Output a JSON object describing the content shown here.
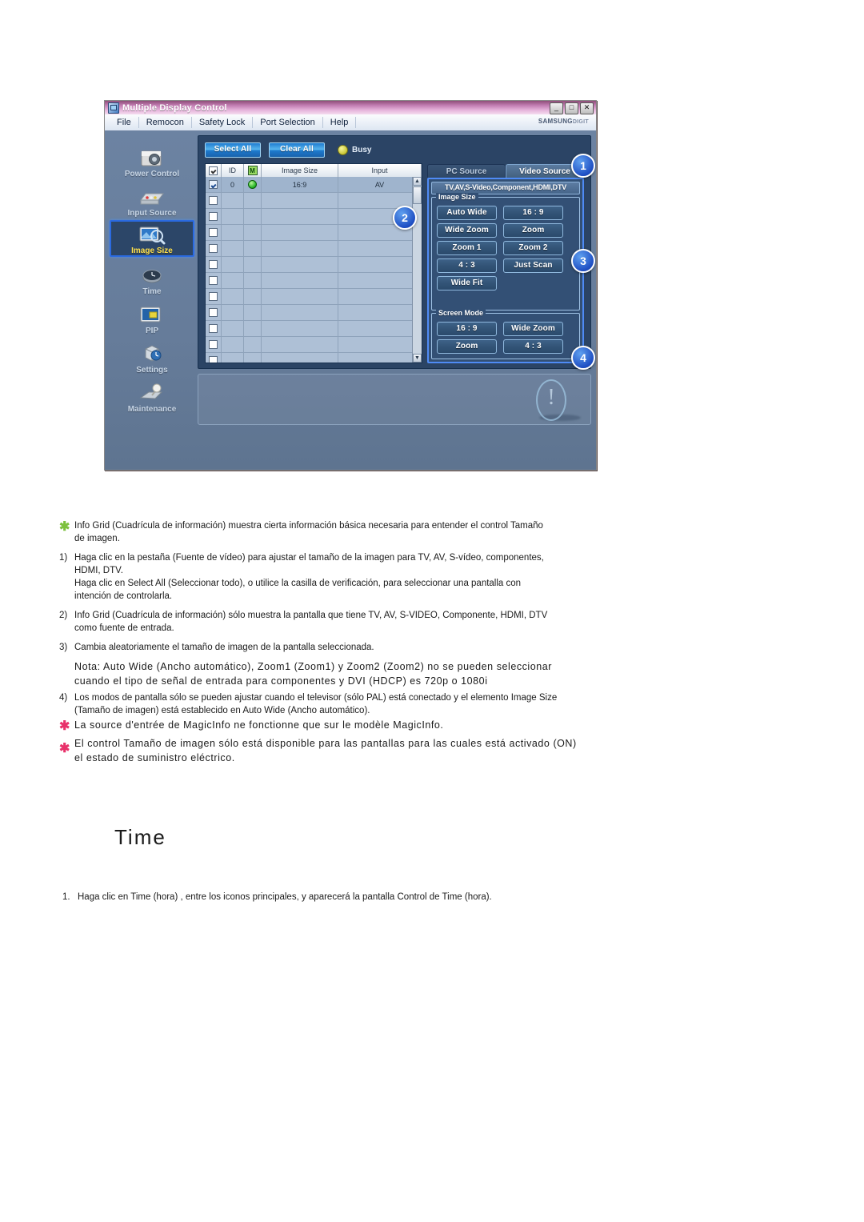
{
  "app": {
    "title": "Multiple Display Control",
    "window_buttons": [
      "_",
      "□",
      "✕"
    ],
    "brand": "SAMSUNG",
    "brand_sub": "DIGIT",
    "menu": [
      "File",
      "Remocon",
      "Safety Lock",
      "Port Selection",
      "Help"
    ],
    "sidebar": [
      {
        "label": "Power Control",
        "icon": "power-control-icon",
        "active": false
      },
      {
        "label": "Input Source",
        "icon": "input-source-icon",
        "active": false
      },
      {
        "label": "Image Size",
        "icon": "image-size-icon",
        "active": true
      },
      {
        "label": "Time",
        "icon": "time-icon",
        "active": false
      },
      {
        "label": "PIP",
        "icon": "pip-icon",
        "active": false
      },
      {
        "label": "Settings",
        "icon": "settings-icon",
        "active": false
      },
      {
        "label": "Maintenance",
        "icon": "maintenance-icon",
        "active": false
      }
    ],
    "toolbar": {
      "select_all": "Select All",
      "clear_all": "Clear All",
      "busy_label": "Busy",
      "busy_color": "#c9c634"
    },
    "grid": {
      "columns": [
        "",
        "ID",
        "",
        "Image Size",
        "Input"
      ],
      "header_check_icon": "checkbox-checked-icon",
      "header_power_icon": "power-column-icon",
      "rows": [
        {
          "checked": true,
          "id": "0",
          "led": "green",
          "image_size": "16:9",
          "input": "AV"
        },
        {
          "checked": false,
          "id": "",
          "led": "",
          "image_size": "",
          "input": ""
        },
        {
          "checked": false,
          "id": "",
          "led": "",
          "image_size": "",
          "input": ""
        },
        {
          "checked": false,
          "id": "",
          "led": "",
          "image_size": "",
          "input": ""
        },
        {
          "checked": false,
          "id": "",
          "led": "",
          "image_size": "",
          "input": ""
        },
        {
          "checked": false,
          "id": "",
          "led": "",
          "image_size": "",
          "input": ""
        },
        {
          "checked": false,
          "id": "",
          "led": "",
          "image_size": "",
          "input": ""
        },
        {
          "checked": false,
          "id": "",
          "led": "",
          "image_size": "",
          "input": ""
        },
        {
          "checked": false,
          "id": "",
          "led": "",
          "image_size": "",
          "input": ""
        },
        {
          "checked": false,
          "id": "",
          "led": "",
          "image_size": "",
          "input": ""
        },
        {
          "checked": false,
          "id": "",
          "led": "",
          "image_size": "",
          "input": ""
        },
        {
          "checked": false,
          "id": "",
          "led": "",
          "image_size": "",
          "input": ""
        }
      ],
      "scroll_up": "▲",
      "scroll_down": "▼"
    },
    "tabs": [
      {
        "label": "PC Source",
        "active": false
      },
      {
        "label": "Video Source",
        "active": true
      }
    ],
    "source_bar": "TV,AV,S-Video,Component,HDMI,DTV",
    "image_size_group": {
      "legend": "Image Size",
      "buttons": [
        "Auto Wide",
        "16 : 9",
        "Wide Zoom",
        "Zoom",
        "Zoom 1",
        "Zoom 2",
        "4 : 3",
        "Just Scan",
        "Wide Fit"
      ]
    },
    "screen_mode_group": {
      "legend": "Screen Mode",
      "buttons": [
        "16 : 9",
        "Wide Zoom",
        "Zoom",
        "4 : 3"
      ]
    },
    "callouts": [
      "1",
      "2",
      "3",
      "4"
    ],
    "accent_color": "#1f4fc4"
  },
  "doc": {
    "bullet1": {
      "marker": "✱",
      "line1": "Info Grid (Cuadrícula de información) muestra cierta información básica necesaria para entender el control Tamaño",
      "line2": "de imagen."
    },
    "item1": {
      "num": "1)",
      "line1": "Haga clic en la pestaña (Fuente de vídeo) para ajustar el tamaño de la imagen para TV, AV, S-vídeo, componentes,",
      "line2": "HDMI, DTV.",
      "line3": "Haga clic en Select All (Seleccionar todo), o utilice la casilla de verificación, para seleccionar una pantalla con",
      "line4": "intención de controlarla."
    },
    "item2": {
      "num": "2)",
      "line1": "Info Grid (Cuadrícula de información) sólo muestra la pantalla que tiene TV, AV, S-VIDEO, Componente, HDMI, DTV",
      "line2": "como fuente de entrada."
    },
    "item3": {
      "num": "3)",
      "line1": "Cambia aleatoriamente el tamaño de imagen de la pantalla seleccionada."
    },
    "note": {
      "line1": "Nota: Auto Wide (Ancho automático), Zoom1 (Zoom1) y Zoom2 (Zoom2) no se pueden seleccionar",
      "line2": "cuando el tipo de señal de entrada para componentes y DVI (HDCP) es 720p o 1080i"
    },
    "item4": {
      "num": "4)",
      "line1": "Los modos de pantalla sólo se pueden ajustar cuando el televisor (sólo PAL) está conectado y el elemento Image Size",
      "line2": "(Tamaño de imagen) está establecido en Auto Wide (Ancho automático)."
    },
    "bullet2": {
      "marker": "✱",
      "line1": "La source d'entrée de MagicInfo ne fonctionne que sur le modèle MagicInfo."
    },
    "bullet3": {
      "marker": "✱",
      "line1": "El control Tamaño de imagen sólo está disponible para las pantallas para las cuales está activado (ON)",
      "line2": "el estado de suministro eléctrico."
    },
    "heading_time": "Time",
    "step1": {
      "num": "1.",
      "text": "Haga clic en Time (hora) , entre los iconos principales, y aparecerá la pantalla Control de Time (hora)."
    }
  }
}
